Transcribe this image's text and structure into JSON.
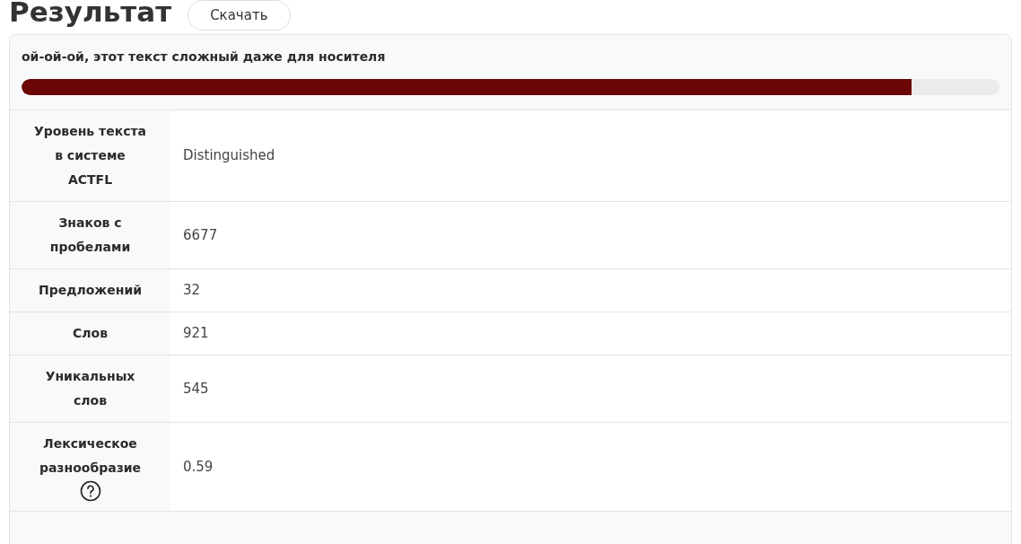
{
  "heading": "Результат",
  "download_button": "Скачать",
  "result": {
    "verdict": "ой-ой-ой, этот текст сложный даже для носителя",
    "level": 0.91
  },
  "rows": [
    {
      "label": "Уровень текста в системе ACTFL",
      "value": "Distinguished",
      "help": false
    },
    {
      "label": "Знаков с пробелами",
      "value": "6677",
      "help": false
    },
    {
      "label": "Предложений",
      "value": "32",
      "help": false
    },
    {
      "label": "Слов",
      "value": "921",
      "help": false
    },
    {
      "label": "Уникальных слов",
      "value": "545",
      "help": false
    },
    {
      "label": "Лексическое разнообразие",
      "value": "0.59",
      "help": true
    }
  ]
}
